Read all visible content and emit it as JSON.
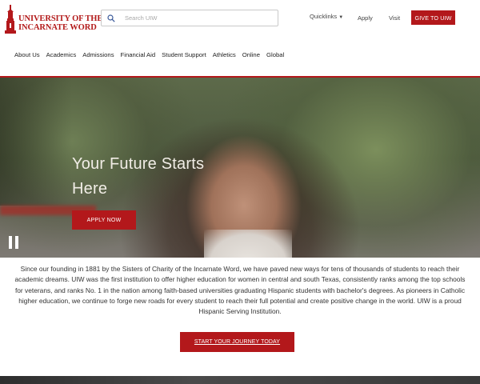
{
  "brand": {
    "name_line1": "UNIVERSITY OF THE",
    "name_line2": "INCARNATE WORD",
    "accent_color": "#b3181b"
  },
  "search": {
    "placeholder": "Search UIW",
    "icon": "search-icon"
  },
  "utility": {
    "quicklinks": "Quicklinks",
    "apply": "Apply",
    "visit": "Visit",
    "give": "GIVE TO UIW"
  },
  "nav": {
    "items": [
      "About Us",
      "Academics",
      "Admissions",
      "Financial Aid",
      "Student Support",
      "Athletics",
      "Online",
      "Global"
    ]
  },
  "hero": {
    "title": "Your Future Starts Here",
    "cta": "APPLY NOW",
    "pause_icon": "pause-icon"
  },
  "intro": {
    "text": "Since our founding in 1881 by the Sisters of Charity of the Incarnate Word, we have paved new ways for tens of thousands of students to reach their academic dreams. UIW was the first institution to offer higher education for women in central and south Texas, consistently ranks among the top schools for veterans, and ranks No. 1 in the nation among faith-based universities graduating Hispanic students with bachelor's degrees. As pioneers in Catholic higher education, we continue to forge new roads for every student to reach their full potential and create positive change in the world. UIW is a proud Hispanic Serving Institution.",
    "cta": "START YOUR JOURNEY TODAY"
  }
}
